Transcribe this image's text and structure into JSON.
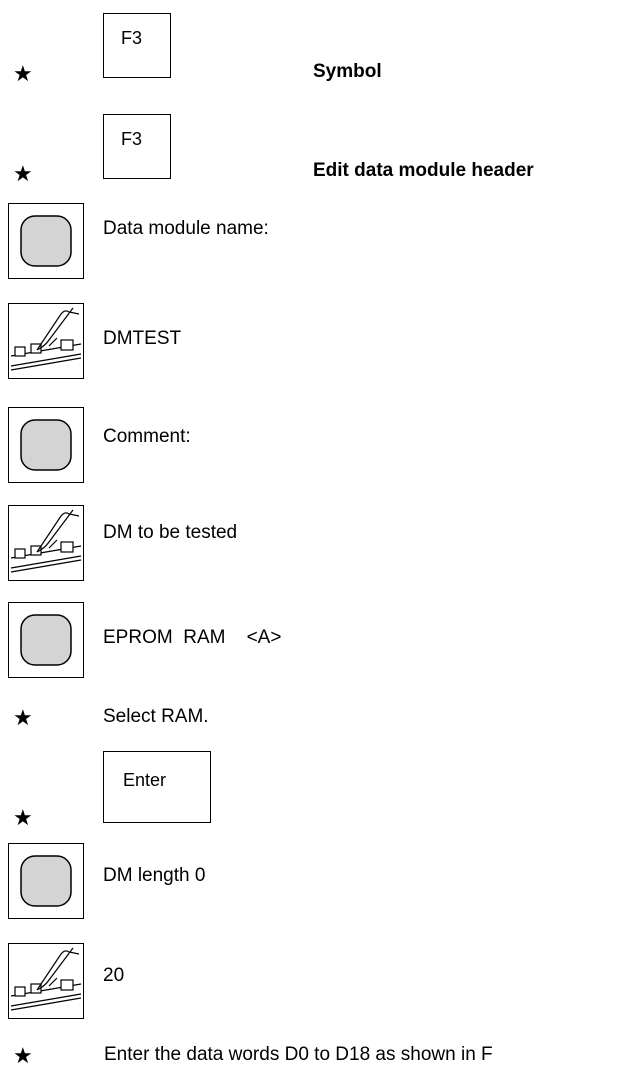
{
  "steps": {
    "s1": {
      "key": "F3",
      "heading": "Symbol"
    },
    "s2": {
      "key": "F3",
      "heading": "Edit data module header"
    },
    "s3": {
      "text": "Data module name:"
    },
    "s4": {
      "text": "DMTEST"
    },
    "s5": {
      "text": "Comment:"
    },
    "s6": {
      "text": "DM to be tested"
    },
    "s7": {
      "text": "EPROM  RAM    <A>"
    },
    "s8": {
      "text": "Select RAM."
    },
    "s9": {
      "key": "Enter"
    },
    "s10": {
      "text": "DM length 0"
    },
    "s11": {
      "text": "20"
    },
    "s12": {
      "text": "Enter the data words D0 to D18 as shown in F"
    }
  },
  "symbols": {
    "star": "★",
    "star_icon": "star-icon",
    "screen_icon": "screen-display-icon",
    "keyboard_icon": "keyboard-input-icon"
  }
}
